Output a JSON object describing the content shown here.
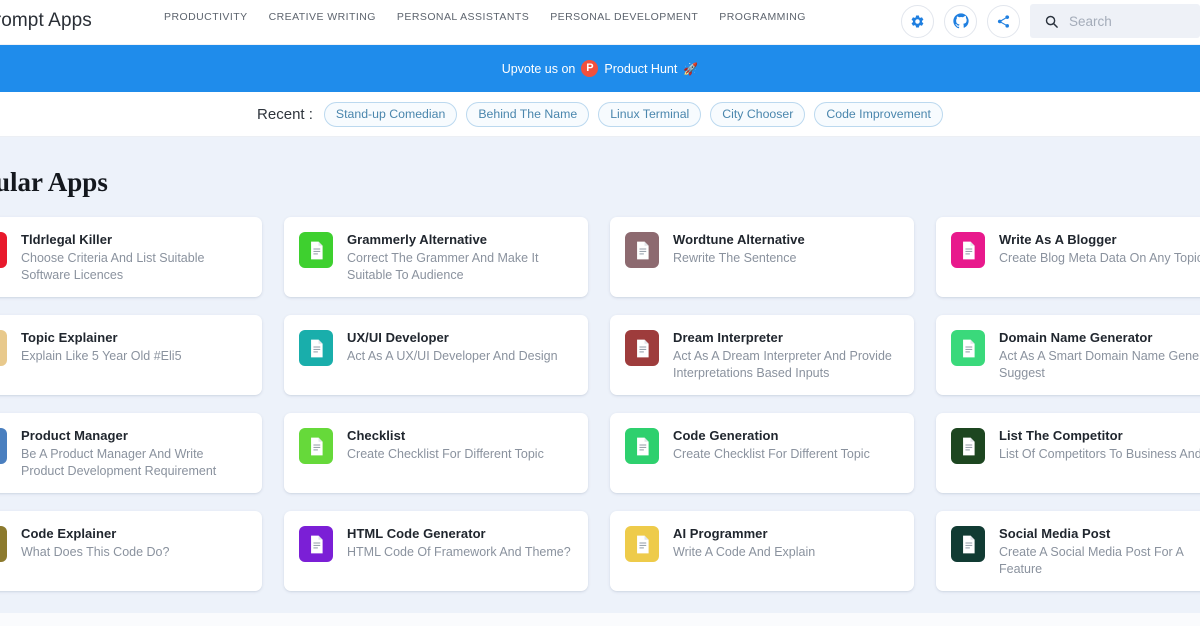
{
  "brand": "Prompt Apps",
  "nav": [
    {
      "label": "PRODUCTIVITY"
    },
    {
      "label": "CREATIVE WRITING"
    },
    {
      "label": "PERSONAL ASSISTANTS"
    },
    {
      "label": "PERSONAL DEVELOPMENT"
    },
    {
      "label": "PROGRAMMING"
    }
  ],
  "header_icons": [
    {
      "name": "gear-icon"
    },
    {
      "name": "github-icon"
    },
    {
      "name": "share-icon"
    }
  ],
  "search": {
    "placeholder": "Search",
    "value": "",
    "icon": "search-icon"
  },
  "banner": {
    "prefix": "Upvote us on",
    "logo_letter": "P",
    "brand": "Product Hunt",
    "rocket": "🚀",
    "bg_color": "#1f8ceb"
  },
  "recent": {
    "label": "Recent :",
    "chips": [
      "Stand-up Comedian",
      "Behind The Name",
      "Linux Terminal",
      "City Chooser",
      "Code Improvement"
    ]
  },
  "popular": {
    "title": "Popular Apps",
    "cards": [
      {
        "title": "Tldrlegal Killer",
        "desc": "Choose Criteria And List Suitable Software Licences",
        "color": "#e8192c"
      },
      {
        "title": "Grammerly Alternative",
        "desc": "Correct The Grammer And Make It Suitable To Audience",
        "color": "#3ed02f"
      },
      {
        "title": "Wordtune Alternative",
        "desc": "Rewrite The Sentence",
        "color": "#8d6a70"
      },
      {
        "title": "Write As A Blogger",
        "desc": "Create Blog Meta Data On Any Topic",
        "color": "#e8198c"
      },
      {
        "title": "Topic Explainer",
        "desc": "Explain Like 5 Year Old #Eli5",
        "color": "#e8c98c"
      },
      {
        "title": "UX/UI Developer",
        "desc": "Act As A UX/UI Developer And Design",
        "color": "#19aeab"
      },
      {
        "title": "Dream Interpreter",
        "desc": "Act As A Dream Interpreter And Provide Interpretations Based Inputs",
        "color": "#9e3c3c"
      },
      {
        "title": "Domain Name Generator",
        "desc": "Act As A Smart Domain Name Generator Suggest",
        "color": "#3ad97b"
      },
      {
        "title": "Product Manager",
        "desc": "Be A Product Manager And Write Product Development Requirement",
        "color": "#4a7fbf"
      },
      {
        "title": "Checklist",
        "desc": "Create Checklist For Different Topic",
        "color": "#66d93a"
      },
      {
        "title": "Code Generation",
        "desc": "Create Checklist For Different Topic",
        "color": "#2ed06e"
      },
      {
        "title": "List The Competitor",
        "desc": "List Of Competitors To Business And For",
        "color": "#1d4620"
      },
      {
        "title": "Code Explainer",
        "desc": "What Does This Code Do?",
        "color": "#8c7a2e"
      },
      {
        "title": "HTML Code Generator",
        "desc": "HTML Code Of Framework And Theme?",
        "color": "#7b1fd6"
      },
      {
        "title": "AI Programmer",
        "desc": "Write A Code And Explain",
        "color": "#eecb4a"
      },
      {
        "title": "Social Media Post",
        "desc": "Create A Social Media Post For A Feature",
        "color": "#113b33"
      }
    ]
  }
}
